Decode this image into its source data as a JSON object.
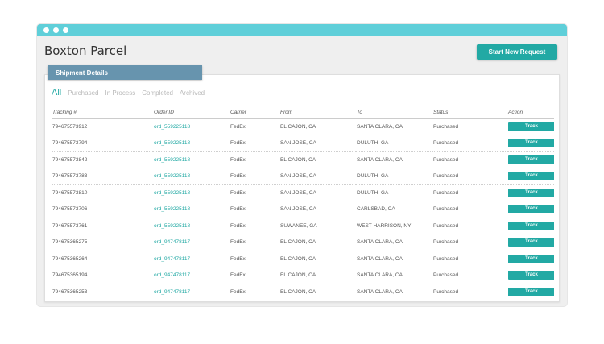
{
  "app": {
    "title": "Boxton Parcel"
  },
  "header": {
    "new_request_label": "Start New Request"
  },
  "section": {
    "label": "Shipment Details"
  },
  "filters": [
    {
      "label": "All",
      "active": true
    },
    {
      "label": "Purchased",
      "active": false
    },
    {
      "label": "In Process",
      "active": false
    },
    {
      "label": "Completed",
      "active": false
    },
    {
      "label": "Archived",
      "active": false
    }
  ],
  "table": {
    "columns": [
      "Tracking #",
      "Order ID",
      "Carrier",
      "From",
      "To",
      "Status",
      "Action"
    ],
    "track_label": "Track",
    "rows": [
      {
        "tracking": "794675573912",
        "order": "ord_559225118",
        "carrier": "FedEx",
        "from": "EL CAJON, CA",
        "to": "SANTA CLARA, CA",
        "status": "Purchased"
      },
      {
        "tracking": "794675573794",
        "order": "ord_559225118",
        "carrier": "FedEx",
        "from": "SAN JOSE, CA",
        "to": "DULUTH, GA",
        "status": "Purchased"
      },
      {
        "tracking": "794675573842",
        "order": "ord_559225118",
        "carrier": "FedEx",
        "from": "EL CAJON, CA",
        "to": "SANTA CLARA, CA",
        "status": "Purchased"
      },
      {
        "tracking": "794675573783",
        "order": "ord_559225118",
        "carrier": "FedEx",
        "from": "SAN JOSE, CA",
        "to": "DULUTH, GA",
        "status": "Purchased"
      },
      {
        "tracking": "794675573810",
        "order": "ord_559225118",
        "carrier": "FedEx",
        "from": "SAN JOSE, CA",
        "to": "DULUTH, GA",
        "status": "Purchased"
      },
      {
        "tracking": "794675573706",
        "order": "ord_559225118",
        "carrier": "FedEx",
        "from": "SAN JOSE, CA",
        "to": "CARLSBAD, CA",
        "status": "Purchased"
      },
      {
        "tracking": "794675573761",
        "order": "ord_559225118",
        "carrier": "FedEx",
        "from": "SUWANEE, GA",
        "to": "WEST HARRISON, NY",
        "status": "Purchased"
      },
      {
        "tracking": "794675365275",
        "order": "ord_947478117",
        "carrier": "FedEx",
        "from": "EL CAJON, CA",
        "to": "SANTA CLARA, CA",
        "status": "Purchased"
      },
      {
        "tracking": "794675365264",
        "order": "ord_947478117",
        "carrier": "FedEx",
        "from": "EL CAJON, CA",
        "to": "SANTA CLARA, CA",
        "status": "Purchased"
      },
      {
        "tracking": "794675365194",
        "order": "ord_947478117",
        "carrier": "FedEx",
        "from": "EL CAJON, CA",
        "to": "SANTA CLARA, CA",
        "status": "Purchased"
      },
      {
        "tracking": "794675365253",
        "order": "ord_947478117",
        "carrier": "FedEx",
        "from": "EL CAJON, CA",
        "to": "SANTA CLARA, CA",
        "status": "Purchased"
      }
    ]
  },
  "colors": {
    "accent": "#22a9a4",
    "titlebar": "#5fcfd9",
    "section_label": "#6794ae"
  }
}
